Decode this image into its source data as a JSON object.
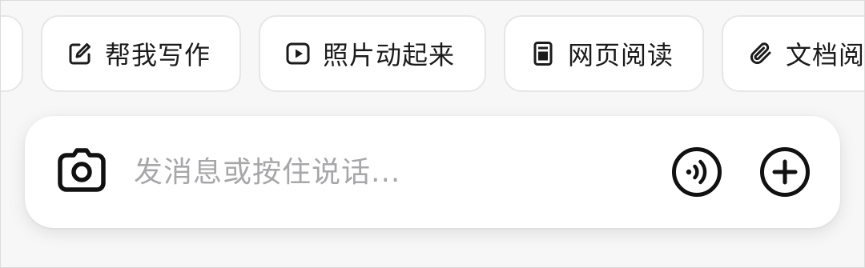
{
  "suggestions": [
    {
      "label": "帮我写作",
      "icon": "edit-icon"
    },
    {
      "label": "照片动起来",
      "icon": "play-icon"
    },
    {
      "label": "网页阅读",
      "icon": "document-icon"
    },
    {
      "label": "文档阅读",
      "icon": "paperclip-icon"
    }
  ],
  "composer": {
    "placeholder": "发消息或按住说话...",
    "left_icon": "camera-icon",
    "voice_icon": "voice-wave-icon",
    "add_icon": "plus-icon"
  }
}
